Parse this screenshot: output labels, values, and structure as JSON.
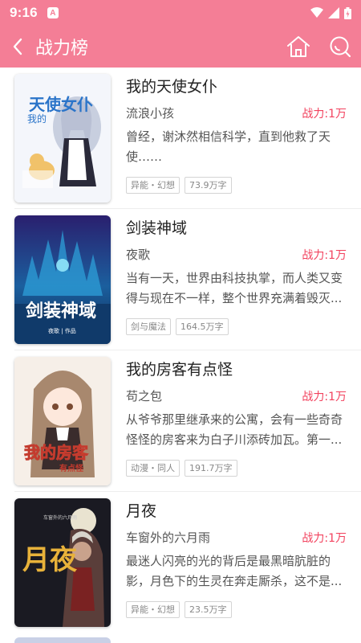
{
  "status": {
    "time": "9:16",
    "notif_letter": "A"
  },
  "app_bar": {
    "title": "战力榜",
    "back_icon": "chevron-left-icon",
    "home_icon": "home-icon",
    "search_icon": "search-icon"
  },
  "books": [
    {
      "title": "我的天使女仆",
      "author": "流浪小孩",
      "power": "战力:1万",
      "desc": "曾经，谢沐然相信科学，直到他救了天使……",
      "tags": [
        "异能・幻想",
        "73.9万字"
      ],
      "cover_text": "天使女仆",
      "cover_sub": "我的"
    },
    {
      "title": "剑装神域",
      "author": "夜歌",
      "power": "战力:1万",
      "desc": "当有一天，世界由科技执掌，而人类又变得与现在不一样，整个世界充满着毁灭...",
      "tags": [
        "剑与魔法",
        "164.5万字"
      ],
      "cover_text": "剑装神域",
      "cover_sub": "夜歌 | 作品"
    },
    {
      "title": "我的房客有点怪",
      "author": "苟之包",
      "power": "战力:1万",
      "desc": "从爷爷那里继承来的公寓，会有一些奇奇怪怪的房客来为白子川添砖加瓦。第一...",
      "tags": [
        "动漫・同人",
        "191.7万字"
      ],
      "cover_text": "我的房客",
      "cover_sub": "有点怪"
    },
    {
      "title": "月夜",
      "author": "车窗外的六月雨",
      "power": "战力:1万",
      "desc": "最迷人闪亮的光的背后是最黑暗肮脏的影，月色下的生灵在奔走厮杀，这不是...",
      "tags": [
        "异能・幻想",
        "23.5万字"
      ],
      "cover_text": "月夜",
      "cover_sub": "车窗外的六月雨"
    }
  ],
  "colors": {
    "accent": "#f47e96",
    "power": "#f2425e"
  }
}
